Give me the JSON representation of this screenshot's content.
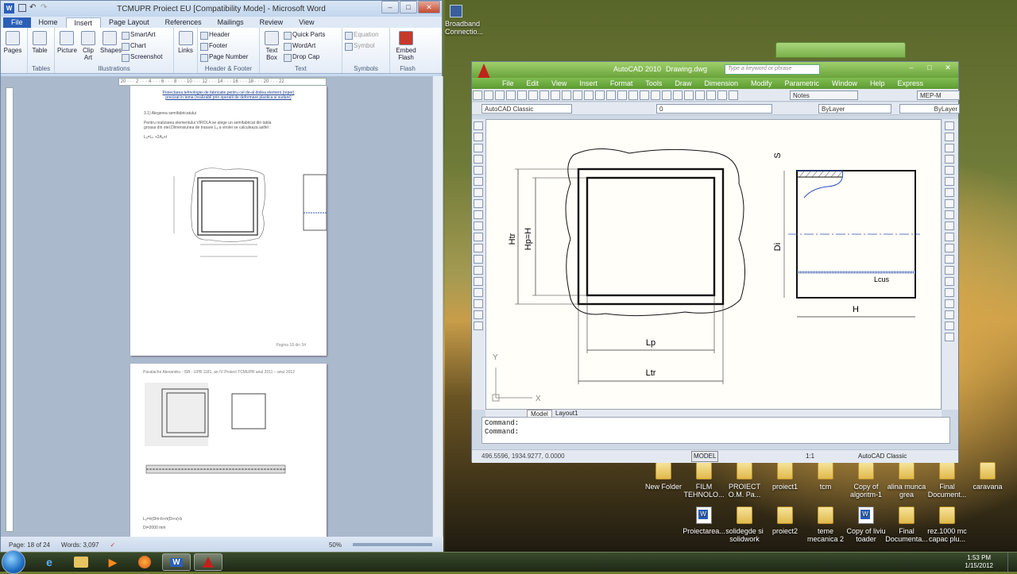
{
  "word": {
    "title": "TCMUPR Proiect EU [Compatibility Mode] - Microsoft Word",
    "tabs": [
      "File",
      "Home",
      "Insert",
      "Page Layout",
      "References",
      "Mailings",
      "Review",
      "View"
    ],
    "selected_tab": "Insert",
    "ribbon": {
      "pages": "Pages",
      "table": "Table",
      "picture": "Picture",
      "clip_art": "Clip Art",
      "shapes": "Shapes",
      "smartart": "SmartArt",
      "chart": "Chart",
      "screenshot": "Screenshot",
      "links": "Links",
      "header": "Header",
      "footer": "Footer",
      "page_number": "Page Number",
      "text_box": "Text Box",
      "quick_parts": "Quick Parts",
      "wordart": "WordArt",
      "drop_cap": "Drop Cap",
      "equation": "Equation",
      "symbol": "Symbol",
      "embed_flash": "Embed Flash",
      "groups": [
        "Tables",
        "Illustrations",
        "Header & Footer",
        "Text",
        "Symbols",
        "Flash"
      ]
    },
    "page1": {
      "header_line1": "Proiectarea tehnologiei de fabricatie pentru cel de-al doilea element (reper)",
      "header_line2": "precizat in tema (realizabil prin operatii de deformare plastica si sudare)",
      "section": "3.1) Alegerea semifabricatului",
      "para1": "Pentru realizarea elementului VIROLA se alege un semifabricat din tabla",
      "para2": "groasa din otel.Dimensiunea de trasare Lₐ a virolei se calculeaza astfel :",
      "formula": "Lₐ=Lₚ +2Aₐ+t",
      "footer": "Pagina 18 din 34"
    },
    "page2": {
      "header": "Pavalache Alexandru - ISB - UPB 1181, an IV        Proiect TCMUPR        anul 2011 – anul 2012",
      "formula1": "Lₐ=π(Dm-b+π(Di+s)-b",
      "formula2": "Di=2000 mm"
    },
    "status": {
      "page": "Page: 18 of 24",
      "words": "Words: 3,097",
      "zoom": "50%"
    }
  },
  "autocad": {
    "title_app": "AutoCAD 2010",
    "title_file": "Drawing.dwg",
    "search_placeholder": "Type a keyword or phrase",
    "menu": [
      "File",
      "Edit",
      "View",
      "Insert",
      "Format",
      "Tools",
      "Draw",
      "Dimension",
      "Modify",
      "Parametric",
      "Window",
      "Help",
      "Express"
    ],
    "workspace": "AutoCAD Classic",
    "layer": "0",
    "color": "ByLayer",
    "linetype": "ByLayer",
    "textstyle": "Notes",
    "mep": "MEP-M",
    "drawing_labels": {
      "htr": "Htr",
      "hp": "Hp=H",
      "lp": "Lp",
      "ltr": "Ltr",
      "s": "S",
      "di": "Di",
      "lcus": "Lcus",
      "h": "H",
      "axis_y": "Y",
      "axis_x": "X"
    },
    "layout_tabs": [
      "Model",
      "Layout1"
    ],
    "command_lines": [
      "Command:",
      "Command:"
    ],
    "coords": "496.5596, 1934.9277, 0.0000",
    "model_label": "MODEL",
    "scale": "1:1",
    "status_workspace": "AutoCAD Classic"
  },
  "desktop": {
    "top_icon": "Broadband Connectio...",
    "icons_row1": [
      "New Folder",
      "FILM TEHNOLO...",
      "PROIECT O.M. Pa...",
      "proiect1",
      "tcm",
      "Copy of algoritm-1",
      "alina munca grea",
      "Final Document...",
      "caravana"
    ],
    "icons_row2": [
      "Proiectarea...",
      "solidegde si solidwork",
      "proiect2",
      "teme mecanica 2",
      "Copy of liviu toader",
      "Final Documenta...",
      "rez.1000 mc capac plu..."
    ]
  },
  "taskbar": {
    "time": "1:53 PM",
    "date": "1/15/2012"
  },
  "colors": {
    "word_blue": "#2a5fb8",
    "acad_green": "#6aa33b",
    "cad_lines": "#111111"
  }
}
